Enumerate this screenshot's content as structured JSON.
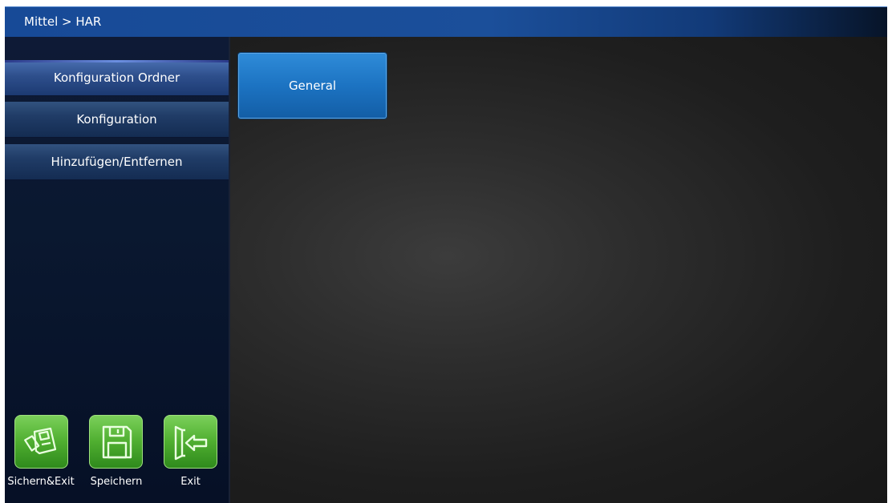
{
  "header": {
    "breadcrumb": "Mittel > HAR"
  },
  "sidebar": {
    "items": [
      {
        "label": "Konfiguration Ordner",
        "active": true
      },
      {
        "label": "Konfiguration",
        "active": false
      },
      {
        "label": "Hinzufügen/Entfernen",
        "active": false
      }
    ]
  },
  "main": {
    "tiles": [
      {
        "label": "General"
      }
    ]
  },
  "actions": [
    {
      "label": "Sichern&Exit",
      "icon": "save-exit-icon"
    },
    {
      "label": "Speichern",
      "icon": "floppy-disk-icon"
    },
    {
      "label": "Exit",
      "icon": "exit-icon"
    }
  ],
  "colors": {
    "header_blue": "#1b4f9a",
    "tile_blue": "#1c73c2",
    "action_green": "#4fae30"
  }
}
